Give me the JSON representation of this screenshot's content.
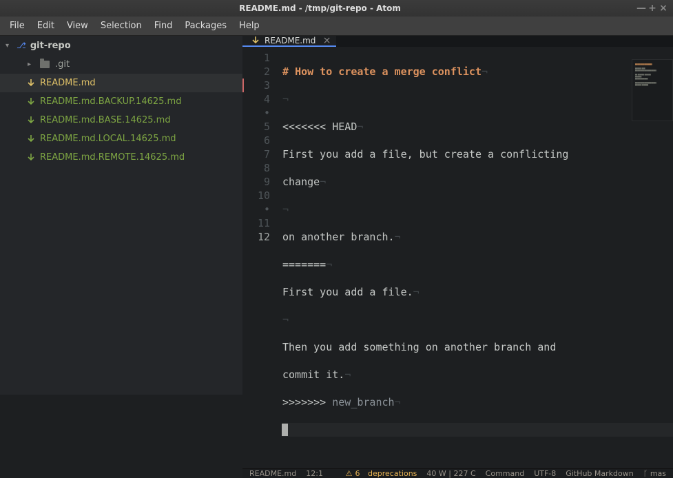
{
  "window": {
    "title": "README.md - /tmp/git-repo - Atom",
    "btn_min": "—",
    "btn_max": "+",
    "btn_close": "×"
  },
  "menu": {
    "items": [
      "File",
      "Edit",
      "View",
      "Selection",
      "Find",
      "Packages",
      "Help"
    ]
  },
  "sidebar": {
    "project": "git-repo",
    "items": [
      {
        "name": ".git",
        "type": "folder"
      },
      {
        "name": "README.md",
        "status": "modified"
      },
      {
        "name": "README.md.BACKUP.14625.md",
        "status": "added"
      },
      {
        "name": "README.md.BASE.14625.md",
        "status": "added"
      },
      {
        "name": "README.md.LOCAL.14625.md",
        "status": "added"
      },
      {
        "name": "README.md.REMOTE.14625.md",
        "status": "added"
      }
    ]
  },
  "tab": {
    "name": "README.md",
    "status": "modified"
  },
  "gutter": [
    "1",
    "2",
    "3",
    "4",
    "•",
    "5",
    "6",
    "7",
    "8",
    "9",
    "10",
    "•",
    "11",
    "12"
  ],
  "code": {
    "l1_hash": "# ",
    "l1_text": "How to create a merge conflict",
    "l2": "",
    "l3": "<<<<<<< HEAD",
    "l4a": "First you add a file, but create a conflicting ",
    "l4b": "change",
    "l5": "",
    "l6": "on another branch.",
    "l7": "=======",
    "l8": "First you add a file.",
    "l9": "",
    "l10a": "Then you add something on another branch and ",
    "l10b": "commit it.",
    "l11a": ">>>>>>> ",
    "l11b": "new_branch"
  },
  "status": {
    "file": "README.md",
    "pos": "12:1",
    "deprec_count": "6",
    "deprec_word": "deprecations",
    "wrap": "40 W | 227 C",
    "mode": "Command",
    "encoding": "UTF-8",
    "grammar": "GitHub Markdown",
    "branch_glyph": "ᚴ",
    "branch": "mas"
  }
}
